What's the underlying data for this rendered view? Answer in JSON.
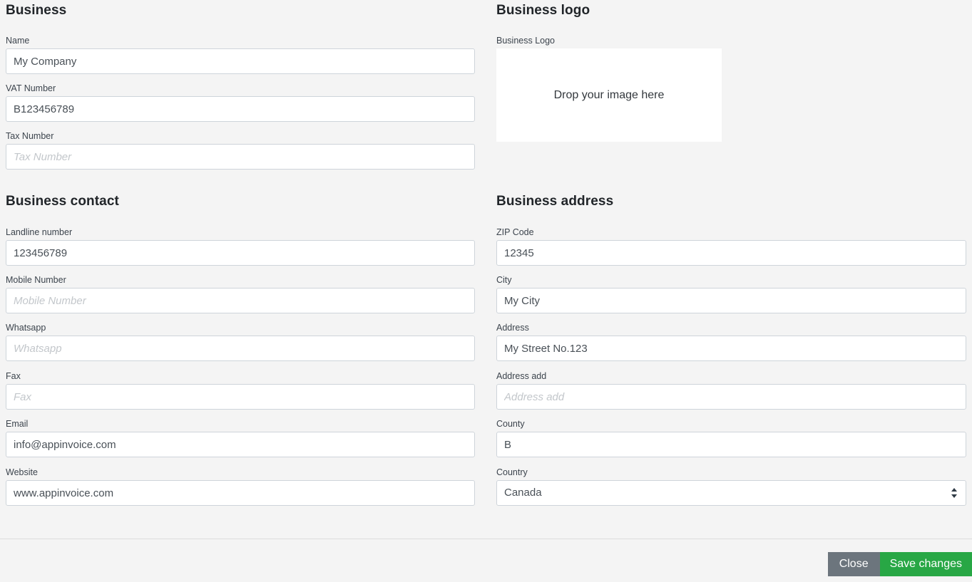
{
  "sections": {
    "business": {
      "title": "Business",
      "fields": [
        {
          "label": "Name",
          "value": "My Company",
          "placeholder": "Name",
          "name": "name"
        },
        {
          "label": "VAT Number",
          "value": "B123456789",
          "placeholder": "VAT Number",
          "name": "vat-number"
        },
        {
          "label": "Tax Number",
          "value": "",
          "placeholder": "Tax Number",
          "name": "tax-number"
        }
      ]
    },
    "business_logo": {
      "title": "Business logo",
      "field_label": "Business Logo",
      "dropzone_text": "Drop your image here"
    },
    "business_contact": {
      "title": "Business contact",
      "fields": [
        {
          "label": "Landline number",
          "value": "123456789",
          "placeholder": "Landline number",
          "name": "landline-number"
        },
        {
          "label": "Mobile Number",
          "value": "",
          "placeholder": "Mobile Number",
          "name": "mobile-number"
        },
        {
          "label": "Whatsapp",
          "value": "",
          "placeholder": "Whatsapp",
          "name": "whatsapp"
        },
        {
          "label": "Fax",
          "value": "",
          "placeholder": "Fax",
          "name": "fax"
        },
        {
          "label": "Email",
          "value": "info@appinvoice.com",
          "placeholder": "Email",
          "name": "email"
        },
        {
          "label": "Website",
          "value": "www.appinvoice.com",
          "placeholder": "Website",
          "name": "website"
        }
      ]
    },
    "business_address": {
      "title": "Business address",
      "fields": [
        {
          "label": "ZIP Code",
          "value": "12345",
          "placeholder": "ZIP Code",
          "name": "zip-code"
        },
        {
          "label": "City",
          "value": "My City",
          "placeholder": "City",
          "name": "city"
        },
        {
          "label": "Address",
          "value": "My Street No.123",
          "placeholder": "Address",
          "name": "address"
        },
        {
          "label": "Address add",
          "value": "",
          "placeholder": "Address add",
          "name": "address-add"
        },
        {
          "label": "County",
          "value": "B",
          "placeholder": "County",
          "name": "county"
        }
      ],
      "country": {
        "label": "Country",
        "selected": "Canada"
      }
    }
  },
  "footer": {
    "close_label": "Close",
    "save_label": "Save changes"
  },
  "colors": {
    "page_background": "#f4f4f4",
    "input_border": "#ced4da",
    "input_text": "#495057",
    "placeholder": "#c3c7cb",
    "heading": "#212529",
    "close_button": "#6c757d",
    "save_button": "#28a745"
  }
}
